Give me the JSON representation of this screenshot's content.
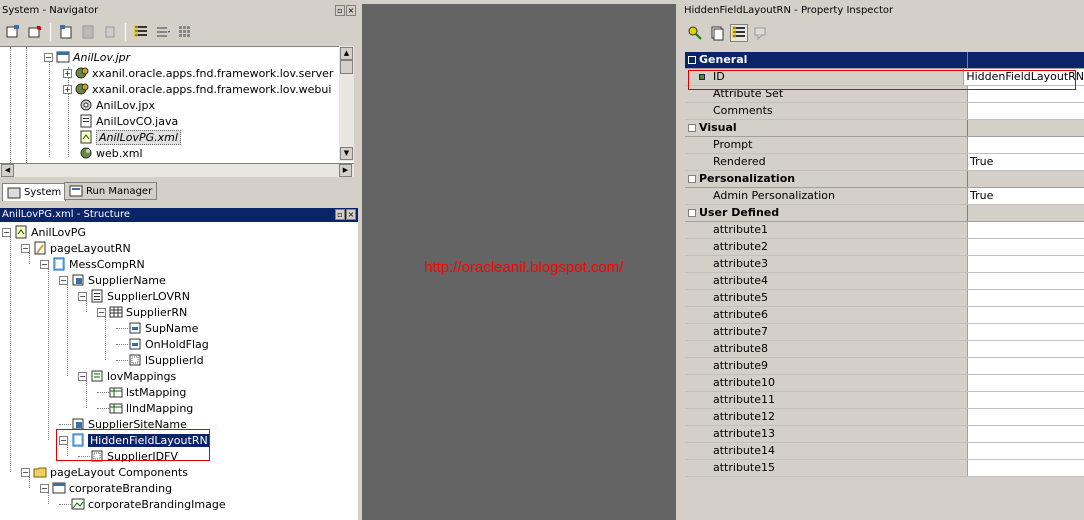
{
  "navigator": {
    "title": "System - Navigator",
    "items": [
      {
        "label": "AnilLov.jpr",
        "style": "italic"
      },
      {
        "label": "xxanil.oracle.apps.fnd.framework.lov.server"
      },
      {
        "label": "xxanil.oracle.apps.fnd.framework.lov.webui"
      },
      {
        "label": "AnilLov.jpx"
      },
      {
        "label": "AnilLovCO.java"
      },
      {
        "label": "AnilLovPG.xml",
        "style": "boxed"
      },
      {
        "label": "web.xml"
      }
    ],
    "tabs": [
      {
        "label": "System",
        "active": true
      },
      {
        "label": "Run Manager",
        "active": false
      }
    ]
  },
  "structure": {
    "title": "AnilLovPG.xml - Structure",
    "nodes": [
      {
        "label": "AnilLovPG",
        "level": 0,
        "icon": "page-icon"
      },
      {
        "label": "pageLayoutRN",
        "level": 1,
        "icon": "page-layout-icon"
      },
      {
        "label": "MessCompRN",
        "level": 2,
        "icon": "region-icon"
      },
      {
        "label": "SupplierName",
        "level": 3,
        "icon": "lov-item-icon"
      },
      {
        "label": "SupplierLOVRN",
        "level": 4,
        "icon": "list-region-icon"
      },
      {
        "label": "SupplierRN",
        "level": 5,
        "icon": "table-region-icon"
      },
      {
        "label": "SupName",
        "level": 6,
        "icon": "text-item-icon"
      },
      {
        "label": "OnHoldFlag",
        "level": 6,
        "icon": "text-item-icon"
      },
      {
        "label": "lSupplierId",
        "level": 6,
        "icon": "hidden-item-icon"
      },
      {
        "label": "lovMappings",
        "level": 4,
        "icon": "mappings-icon"
      },
      {
        "label": "lstMapping",
        "level": 5,
        "icon": "mapping-icon"
      },
      {
        "label": "llndMapping",
        "level": 5,
        "icon": "mapping-icon"
      },
      {
        "label": "SupplierSiteName",
        "level": 3,
        "icon": "lov-item-icon"
      },
      {
        "label": "HiddenFieldLayoutRN",
        "level": 3,
        "icon": "region-icon",
        "selected": true
      },
      {
        "label": "SupplierIDFV",
        "level": 4,
        "icon": "hidden-item-icon"
      },
      {
        "label": "pageLayout Components",
        "level": 1,
        "icon": "folder-icon"
      },
      {
        "label": "corporateBranding",
        "level": 2,
        "icon": "branding-icon"
      },
      {
        "label": "corporateBrandingImage",
        "level": 3,
        "icon": "image-icon"
      }
    ]
  },
  "watermark": "http://oracleanil.blogspot.com/",
  "inspector": {
    "title": "HiddenFieldLayoutRN - Property Inspector",
    "groups": [
      {
        "name": "General",
        "active": true,
        "props": [
          {
            "name": "ID",
            "value": "HiddenFieldLayoutRN",
            "marked": true
          },
          {
            "name": "Attribute Set",
            "value": ""
          },
          {
            "name": "Comments",
            "value": ""
          }
        ]
      },
      {
        "name": "Visual",
        "props": [
          {
            "name": "Prompt",
            "value": ""
          },
          {
            "name": "Rendered",
            "value": "True"
          }
        ]
      },
      {
        "name": "Personalization",
        "props": [
          {
            "name": "Admin Personalization",
            "value": "True"
          }
        ]
      },
      {
        "name": "User Defined",
        "props": [
          {
            "name": "attribute1",
            "value": ""
          },
          {
            "name": "attribute2",
            "value": ""
          },
          {
            "name": "attribute3",
            "value": ""
          },
          {
            "name": "attribute4",
            "value": ""
          },
          {
            "name": "attribute5",
            "value": ""
          },
          {
            "name": "attribute6",
            "value": ""
          },
          {
            "name": "attribute7",
            "value": ""
          },
          {
            "name": "attribute8",
            "value": ""
          },
          {
            "name": "attribute9",
            "value": ""
          },
          {
            "name": "attribute10",
            "value": ""
          },
          {
            "name": "attribute11",
            "value": ""
          },
          {
            "name": "attribute12",
            "value": ""
          },
          {
            "name": "attribute13",
            "value": ""
          },
          {
            "name": "attribute14",
            "value": ""
          },
          {
            "name": "attribute15",
            "value": ""
          }
        ]
      }
    ]
  },
  "colors": {
    "selection": "#0a246a",
    "highlight": "#e00000",
    "watermark": "#ff0000",
    "editor_bg": "#646464"
  }
}
